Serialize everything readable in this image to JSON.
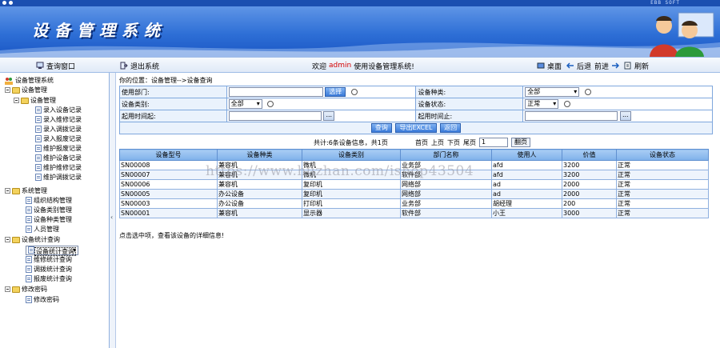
{
  "app": {
    "title": "设备管理系统",
    "corner_text": "EBB SOFT",
    "colors": {
      "banner": "#2e6fd6",
      "header_row": "#7fb1ea",
      "accent_red": "#d40000"
    }
  },
  "toolbar": {
    "query_window": "查询窗口",
    "exit_system": "退出系统",
    "welcome_prefix": "欢迎",
    "user": "admin",
    "welcome_suffix": "使用设备管理系统!",
    "desktop": "桌面",
    "back": "后退",
    "forward": "前进",
    "refresh": "刷新"
  },
  "sidebar": {
    "root": "设备管理系统",
    "groups": [
      {
        "label": "设备管理"
      },
      {
        "label": "设备管理",
        "items": [
          "录入设备记录",
          "录入维修记录",
          "录入调拨记录",
          "录入报废记录",
          "维护报废记录",
          "维护设备记录",
          "维护维修记录",
          "维护调拨记录"
        ]
      },
      {
        "label": "系统管理",
        "items": [
          "组织结构管理",
          "设备类别管理",
          "设备种类管理",
          "人员管理"
        ]
      },
      {
        "label": "设备统计查询",
        "items": [
          "设备统计查询",
          "维修统计查询",
          "调拨统计查询",
          "报废统计查询"
        ]
      },
      {
        "label": "修改密码",
        "items": [
          "修改密码"
        ]
      }
    ]
  },
  "breadcrumb": "你的位置：设备管理-->设备查询",
  "form": {
    "dept_label": "使用部门:",
    "choose_button": "选择",
    "kind_label": "设备种类:",
    "kind_value": "全部",
    "category_label": "设备类别:",
    "category_value": "全部",
    "status_label": "设备状态:",
    "status_value": "正常",
    "start_label": "起用时间起:",
    "end_label": "起用时间止:",
    "dots": "...",
    "query_button": "查询",
    "export_button": "导出EXCEL",
    "return_button": "返回"
  },
  "pager": {
    "count_text": "共计:6条设备信息，共1页",
    "first": "首页",
    "prev": "上页",
    "next": "下页",
    "last": "尾页",
    "page_value": "1",
    "go": "翻页"
  },
  "table": {
    "columns": [
      "设备型号",
      "设备种类",
      "设备类别",
      "部门名称",
      "使用人",
      "价值",
      "设备状态"
    ],
    "rows": [
      [
        "SN00008",
        "兼容机",
        "微机",
        "业务部",
        "afd",
        "3200",
        "正常"
      ],
      [
        "SN00007",
        "兼容机",
        "微机",
        "软件部",
        "afd",
        "3200",
        "正常"
      ],
      [
        "SN00006",
        "兼容机",
        "复印机",
        "网络部",
        "ad",
        "2000",
        "正常"
      ],
      [
        "SN00005",
        "办公设备",
        "复印机",
        "网络部",
        "ad",
        "2000",
        "正常"
      ],
      [
        "SN00003",
        "办公设备",
        "打印机",
        "业务部",
        "胡经理",
        "200",
        "正常"
      ],
      [
        "SN00001",
        "兼容机",
        "显示器",
        "软件部",
        "小王",
        "3000",
        "正常"
      ]
    ]
  },
  "note": "点击选中项，查看该设备的详细信息!",
  "watermark": "https://www.huzhan.com/ishop43504"
}
